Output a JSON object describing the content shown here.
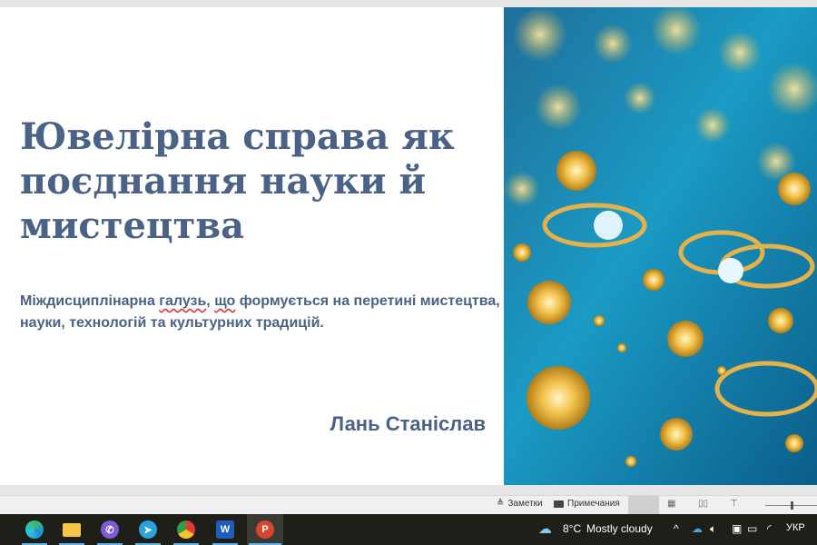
{
  "slide": {
    "title": "Ювелірна справа як поєднання науки й мистецтва",
    "subtitle_pre": "Міждисциплінарна ",
    "subtitle_err1": "галузь",
    "subtitle_mid": ", ",
    "subtitle_err2": "що",
    "subtitle_post": " формується на перетині мистецтва, науки, технологій та культурних традицій.",
    "author": "Лань Станіслав"
  },
  "statusbar": {
    "notes": "Заметки",
    "comments": "Примечания"
  },
  "taskbar": {
    "apps": [
      "Edge",
      "File Explorer",
      "Viber",
      "Telegram",
      "Chrome",
      "Word",
      "PowerPoint"
    ],
    "weather_temp": "8°C",
    "weather_text": "Mostly cloudy",
    "language": "УКР"
  }
}
